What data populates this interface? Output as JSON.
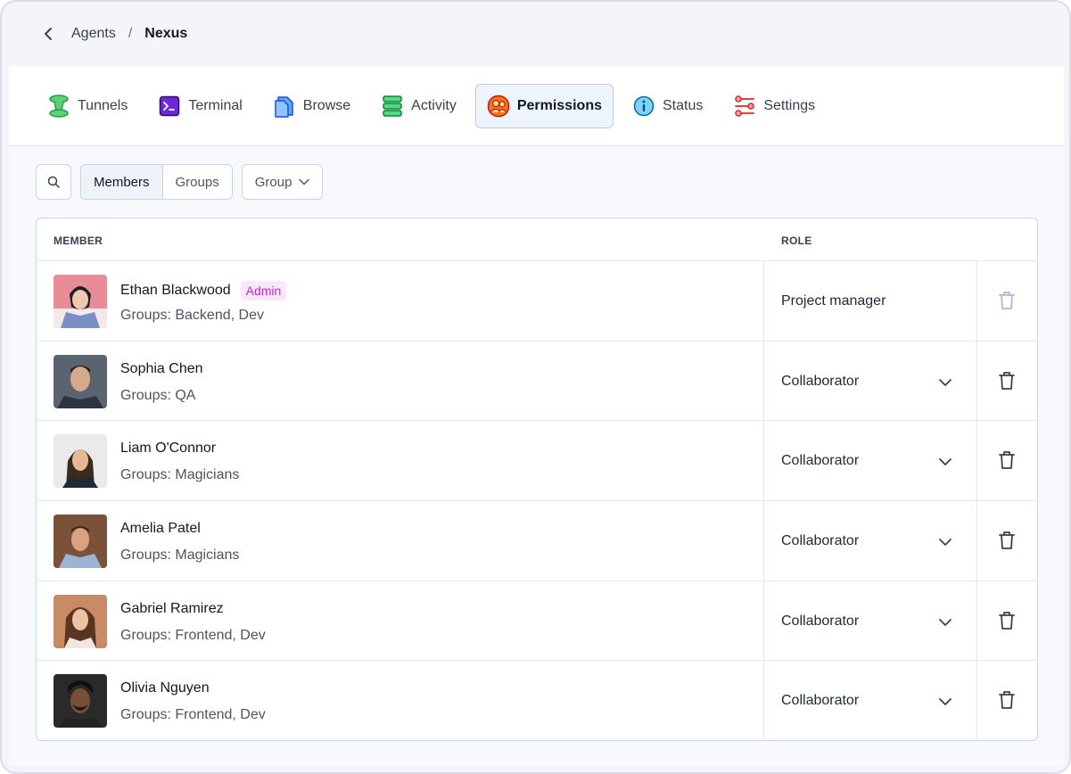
{
  "breadcrumb": {
    "parent": "Agents",
    "separator": "/",
    "current": "Nexus"
  },
  "tabs": [
    {
      "label": "Tunnels",
      "icon": "tunnel-icon",
      "active": false
    },
    {
      "label": "Terminal",
      "icon": "terminal-icon",
      "active": false
    },
    {
      "label": "Browse",
      "icon": "browse-icon",
      "active": false
    },
    {
      "label": "Activity",
      "icon": "activity-icon",
      "active": false
    },
    {
      "label": "Permissions",
      "icon": "permissions-icon",
      "active": true
    },
    {
      "label": "Status",
      "icon": "info-icon",
      "active": false
    },
    {
      "label": "Settings",
      "icon": "settings-icon",
      "active": false
    }
  ],
  "toolbar": {
    "segments": [
      "Members",
      "Groups"
    ],
    "selected_segment": "Members",
    "group_dropdown": "Group"
  },
  "table": {
    "headers": {
      "member": "MEMBER",
      "role": "ROLE"
    },
    "rows": [
      {
        "name": "Ethan Blackwood",
        "badge": "Admin",
        "groups": "Groups: Backend, Dev",
        "role": "Project manager",
        "editable": false
      },
      {
        "name": "Sophia Chen",
        "badge": "",
        "groups": "Groups: QA",
        "role": "Collaborator",
        "editable": true
      },
      {
        "name": "Liam O'Connor",
        "badge": "",
        "groups": "Groups: Magicians",
        "role": "Collaborator",
        "editable": true
      },
      {
        "name": "Amelia Patel",
        "badge": "",
        "groups": "Groups: Magicians",
        "role": "Collaborator",
        "editable": true
      },
      {
        "name": "Gabriel Ramirez",
        "badge": "",
        "groups": "Groups: Frontend, Dev",
        "role": "Collaborator",
        "editable": true
      },
      {
        "name": "Olivia Nguyen",
        "badge": "",
        "groups": "Groups: Frontend, Dev",
        "role": "Collaborator",
        "editable": true
      }
    ]
  },
  "colors": {
    "accent_border": "#b8cde6",
    "admin_badge_bg": "#fbe7fb",
    "admin_badge_text": "#c026d3",
    "disabled_trash": "#a9bbd6"
  }
}
